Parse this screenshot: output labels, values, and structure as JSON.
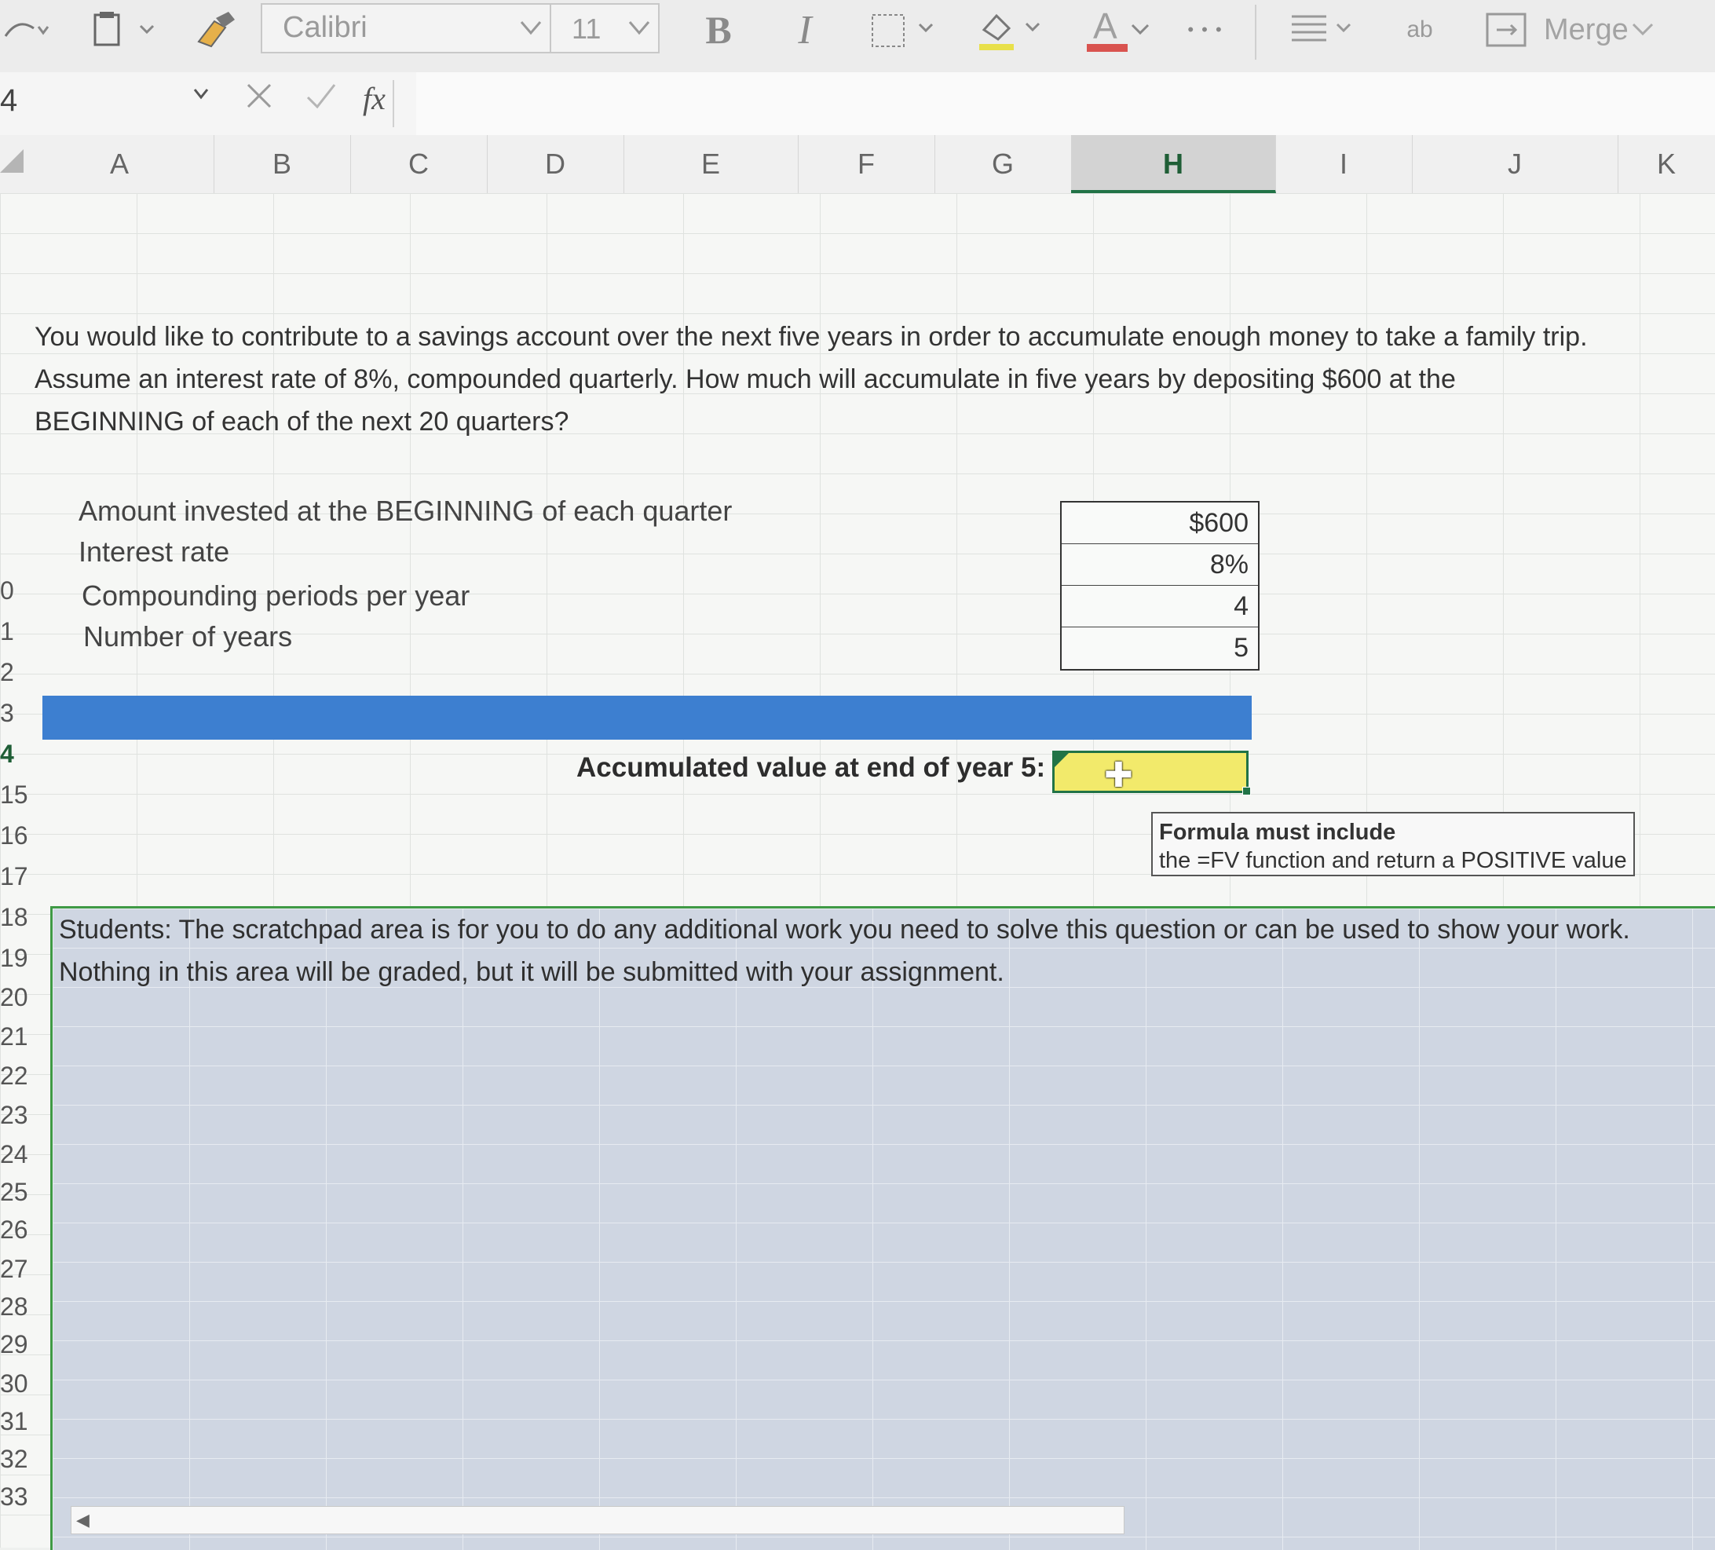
{
  "ribbon": {
    "font_name": "Calibri",
    "font_size": "11",
    "bold_label": "B",
    "italic_label": "I",
    "font_color_label": "A",
    "more_label": "• • •",
    "wrap_label": "ab",
    "merge_label": "Merge"
  },
  "formula_bar": {
    "name_box": "4",
    "fx_label": "fx",
    "content": ""
  },
  "columns": [
    "A",
    "B",
    "C",
    "D",
    "E",
    "F",
    "G",
    "H",
    "I",
    "J",
    "K"
  ],
  "selected_column": "H",
  "rows": [
    "0",
    "1",
    "2",
    "3",
    "4",
    "15",
    "16",
    "17",
    "18",
    "19",
    "20",
    "21",
    "22",
    "23",
    "24",
    "25",
    "26",
    "27",
    "28",
    "29",
    "30",
    "31",
    "32",
    "33"
  ],
  "question": "You would like to contribute to a savings account over the next five years in order to accumulate enough money to take a family trip. Assume an interest rate of 8%, compounded quarterly. How much will accumulate in five years by depositing $600 at the BEGINNING of each of the next 20 quarters?",
  "inputs": [
    {
      "label": "Amount invested at the BEGINNING of each quarter",
      "value": "$600"
    },
    {
      "label": "Interest rate",
      "value": "8%"
    },
    {
      "label": "Compounding periods per year",
      "value": "4"
    },
    {
      "label": "Number of years",
      "value": "5"
    }
  ],
  "result": {
    "label": "Accumulated value at end of year 5:",
    "value": ""
  },
  "note": {
    "title": "Formula must include",
    "body": "the =FV function and return a POSITIVE value"
  },
  "scratchpad": {
    "line1": "Students: The scratchpad area is for you to do any additional work you need to solve this question or can be used to show your work.",
    "line2": "Nothing in this area will be graded, but it will be submitted with your assignment."
  },
  "colors": {
    "accent_green": "#217346",
    "answer_fill": "#f2ea6b",
    "header_bar_blue": "#3d7fd0",
    "scratch_fill": "#cfd6e2"
  }
}
